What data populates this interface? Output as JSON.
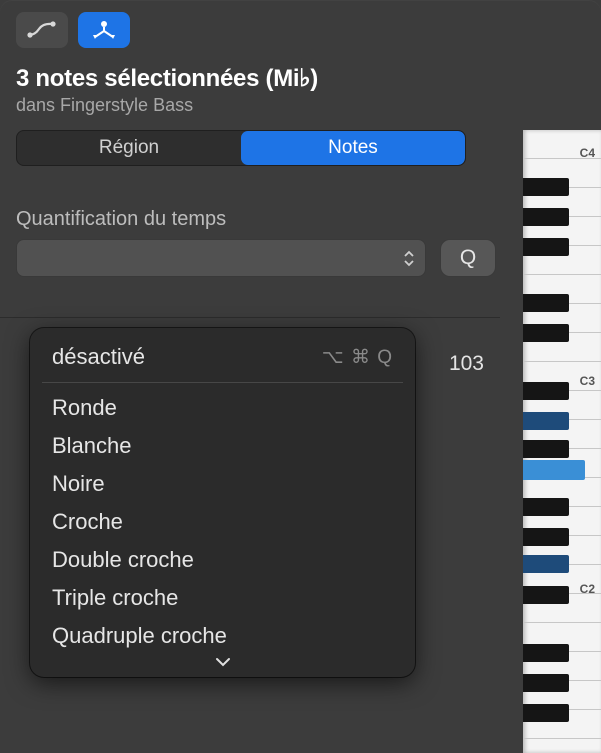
{
  "toolbar": {
    "automation_icon": "automation-curve-icon",
    "midi_icon": "midi-tool-icon"
  },
  "header": {
    "title": "3 notes sélectionnées (Mi♭)",
    "subtitle": "dans Fingerstyle Bass"
  },
  "tabs": {
    "region": "Région",
    "notes": "Notes"
  },
  "quantize": {
    "label": "Quantification du temps",
    "button": "Q",
    "selected": "",
    "menu": {
      "off": "désactivé",
      "off_shortcut": "⌥ ⌘ Q",
      "items": [
        "Ronde",
        "Blanche",
        "Noire",
        "Croche",
        "Double croche",
        "Triple croche",
        "Quadruple croche"
      ]
    }
  },
  "value_display": "103",
  "piano": {
    "labels": {
      "c4": "C4",
      "c3": "C3",
      "c2": "C2"
    }
  }
}
